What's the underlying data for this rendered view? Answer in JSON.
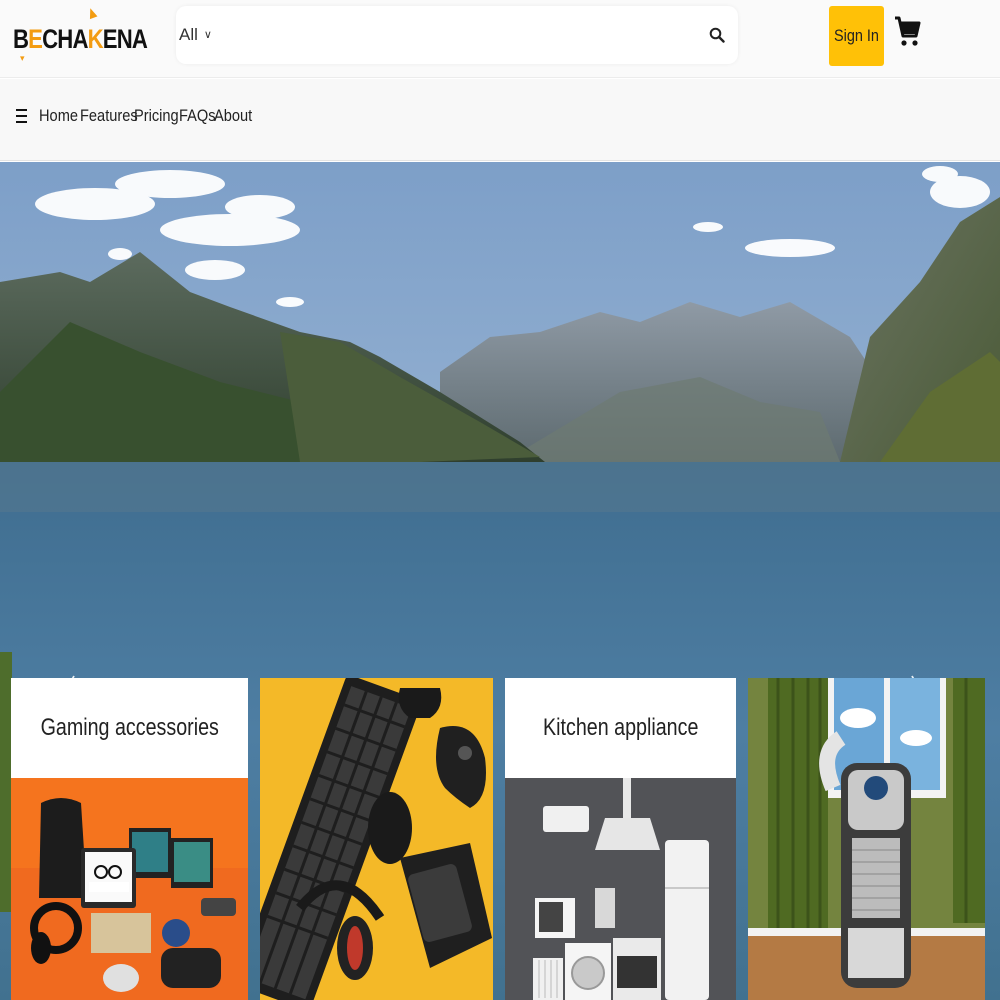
{
  "brand": {
    "logo_text_1": "B",
    "logo_text_2": "E",
    "logo_text_3": "CHA",
    "logo_text_4": "K",
    "logo_text_5": "ENA"
  },
  "search": {
    "category": "All",
    "placeholder": ""
  },
  "header": {
    "signin_label": "Sign In"
  },
  "nav": {
    "items": [
      {
        "label": "Home"
      },
      {
        "label": "Features"
      },
      {
        "label": "Pricing"
      },
      {
        "label": "FAQs"
      },
      {
        "label": "About"
      }
    ]
  },
  "cards": [
    {
      "title": "Gaming accessories"
    },
    {
      "title": ""
    },
    {
      "title": "Kitchen appliance"
    },
    {
      "title": ""
    }
  ],
  "colors": {
    "accent": "#ffc107",
    "brand_orange": "#f39c12"
  }
}
